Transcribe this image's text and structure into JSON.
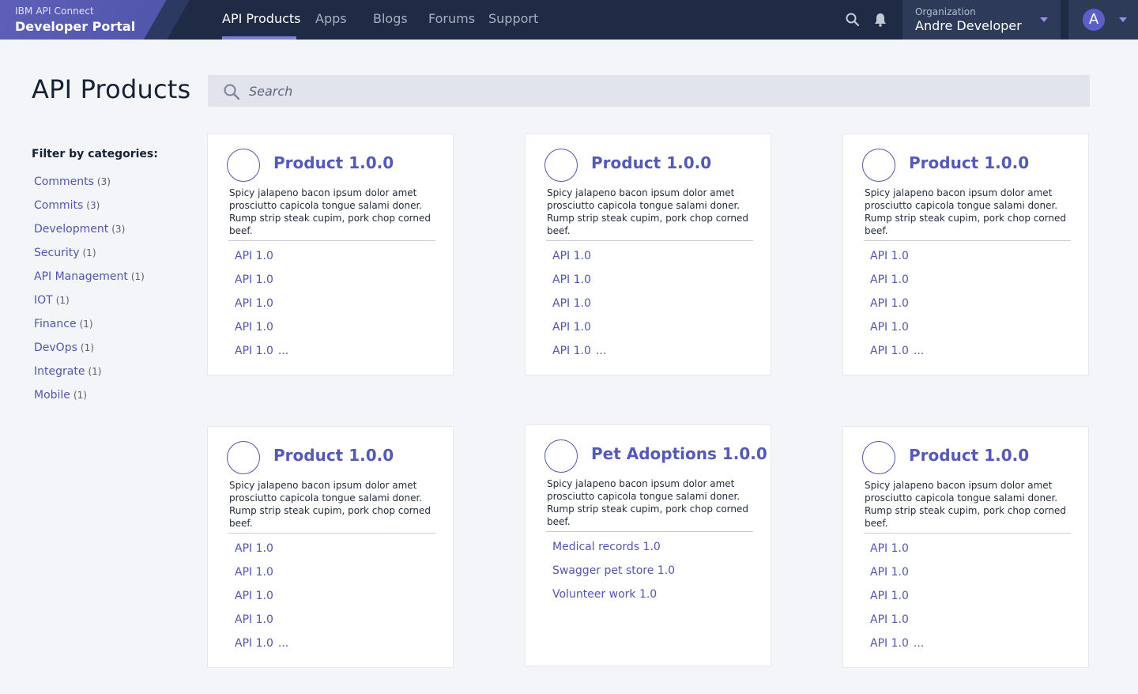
{
  "brand": {
    "top": "IBM API Connect",
    "main": "Developer Portal"
  },
  "nav": [
    {
      "label": "API Products",
      "active": true
    },
    {
      "label": "Apps",
      "active": false
    },
    {
      "label": "Blogs",
      "active": false
    },
    {
      "label": "Forums",
      "active": false
    },
    {
      "label": "Support",
      "active": false
    }
  ],
  "header_icons": [
    "search-icon",
    "notification-bell-icon"
  ],
  "organization": {
    "label": "Organization",
    "name": "Andre Developer"
  },
  "user": {
    "initial": "A"
  },
  "page": {
    "title": "API Products"
  },
  "search": {
    "placeholder": "Search",
    "value": ""
  },
  "filter": {
    "title": "Filter by categories:",
    "categories": [
      {
        "label": "Comments",
        "count": "(3)"
      },
      {
        "label": "Commits",
        "count": "(3)"
      },
      {
        "label": "Development",
        "count": "(3)"
      },
      {
        "label": "Security",
        "count": "(1)"
      },
      {
        "label": "API Management",
        "count": "(1)"
      },
      {
        "label": "IOT",
        "count": "(1)"
      },
      {
        "label": "Finance",
        "count": "(1)"
      },
      {
        "label": "DevOps",
        "count": "(1)"
      },
      {
        "label": "Integrate",
        "count": "(1)"
      },
      {
        "label": "Mobile",
        "count": "(1)"
      }
    ]
  },
  "more_marker": "...",
  "products": [
    {
      "title": "Product 1.0.0",
      "description": "Spicy jalapeno bacon ipsum dolor amet prosciutto capicola tongue salami doner. Rump strip steak cupim, pork chop corned beef.",
      "apis": [
        "API 1.0",
        "API 1.0",
        "API 1.0",
        "API 1.0",
        "API 1.0"
      ],
      "has_more": true
    },
    {
      "title": "Product 1.0.0",
      "description": "Spicy jalapeno bacon ipsum dolor amet prosciutto capicola tongue salami doner. Rump strip steak cupim, pork chop corned beef.",
      "apis": [
        "API 1.0",
        "API 1.0",
        "API 1.0",
        "API 1.0",
        "API 1.0"
      ],
      "has_more": true
    },
    {
      "title": "Product 1.0.0",
      "description": "Spicy jalapeno bacon ipsum dolor amet prosciutto capicola tongue salami doner. Rump strip steak cupim, pork chop corned beef.",
      "apis": [
        "API 1.0",
        "API 1.0",
        "API 1.0",
        "API 1.0",
        "API 1.0"
      ],
      "has_more": true
    },
    {
      "title": "Product 1.0.0",
      "description": "Spicy jalapeno bacon ipsum dolor amet prosciutto capicola tongue salami doner. Rump strip steak cupim, pork chop corned beef.",
      "apis": [
        "API 1.0",
        "API 1.0",
        "API 1.0",
        "API 1.0",
        "API 1.0"
      ],
      "has_more": true
    },
    {
      "title": "Pet Adoptions 1.0.0",
      "description": "Spicy jalapeno bacon ipsum dolor amet prosciutto capicola tongue salami doner. Rump strip steak cupim, pork chop corned beef.",
      "apis": [
        "Medical records 1.0",
        "Swagger pet store 1.0",
        "Volunteer work 1.0"
      ],
      "has_more": false
    },
    {
      "title": "Product 1.0.0",
      "description": "Spicy jalapeno bacon ipsum dolor amet prosciutto capicola tongue salami doner. Rump strip steak cupim, pork chop corned beef.",
      "apis": [
        "API 1.0",
        "API 1.0",
        "API 1.0",
        "API 1.0",
        "API 1.0"
      ],
      "has_more": true
    }
  ],
  "colors": {
    "topbar": "#1f2a44",
    "brand": "#5e5fb8",
    "accent": "#5056b0",
    "active_underline": "#7b7fd6",
    "page_background": "#f4f5f8"
  }
}
